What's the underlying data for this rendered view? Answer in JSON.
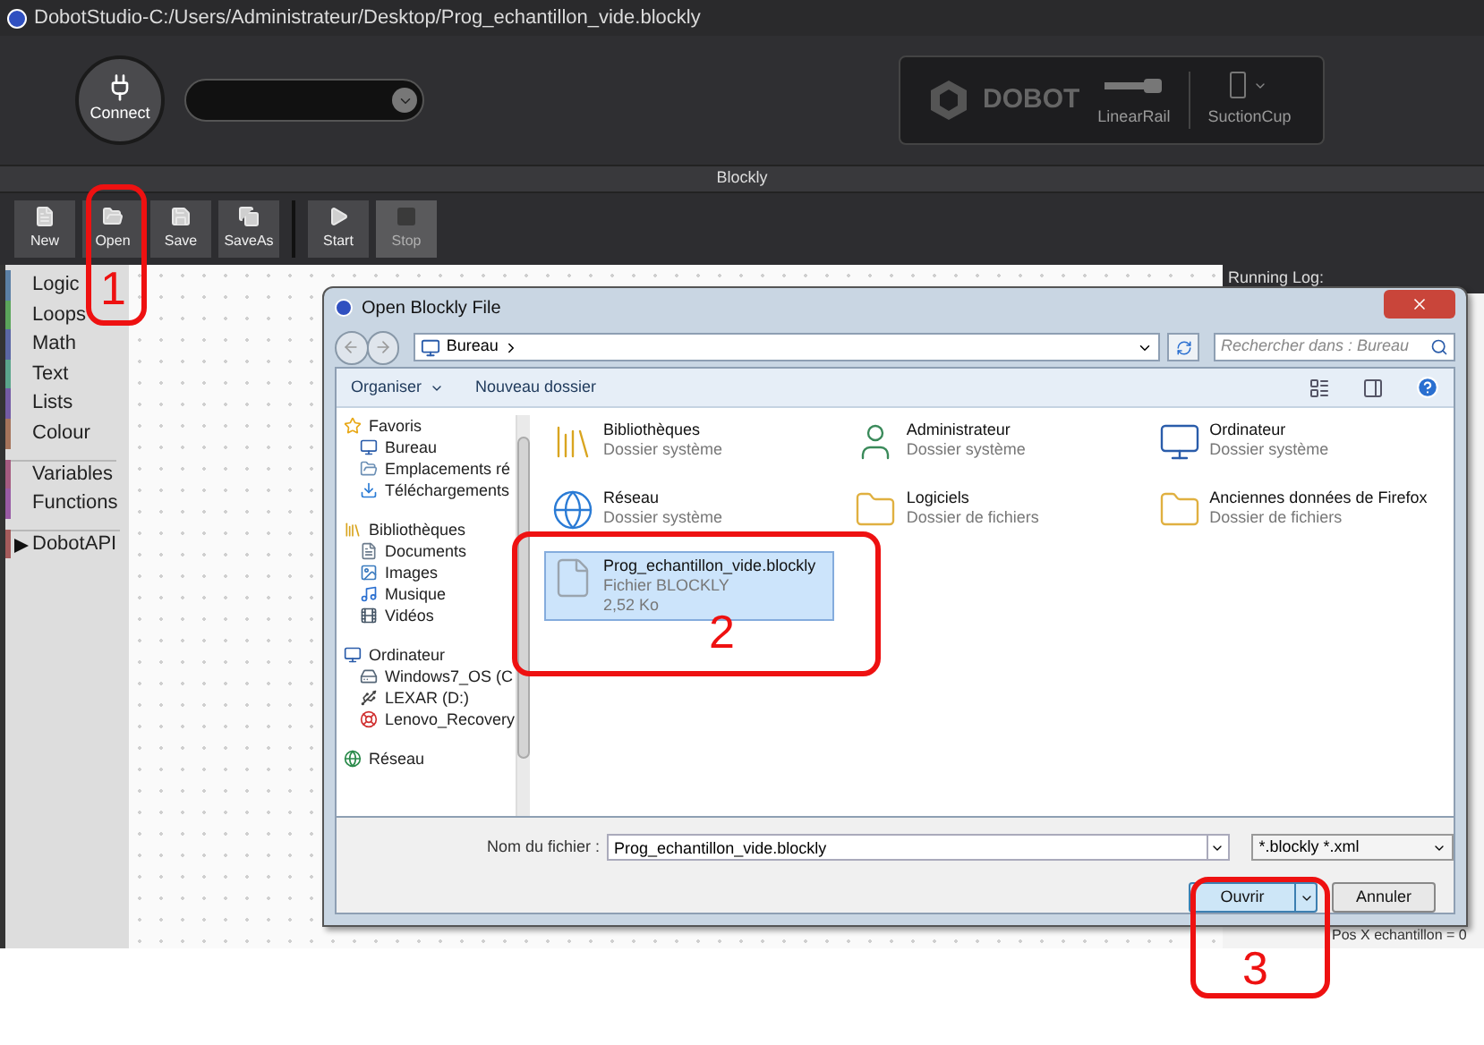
{
  "window": {
    "title": "DobotStudio-C:/Users/Administrateur/Desktop/Prog_echantillon_vide.blockly"
  },
  "header": {
    "connect": {
      "label": "Connect"
    },
    "brand": "DOBOT",
    "devices": [
      {
        "label": "LinearRail",
        "kind": "rail"
      },
      {
        "label": "SuctionCup",
        "kind": "cup"
      }
    ]
  },
  "section_title": "Blockly",
  "toolbar": [
    {
      "label": "New",
      "kind": "new",
      "disabled": false
    },
    {
      "label": "Open",
      "kind": "open",
      "disabled": false
    },
    {
      "label": "Save",
      "kind": "save",
      "disabled": false
    },
    {
      "label": "SaveAs",
      "kind": "saveas",
      "disabled": false
    },
    {
      "label": "Start",
      "kind": "start",
      "disabled": false
    },
    {
      "label": "Stop",
      "kind": "stop",
      "disabled": true
    }
  ],
  "categories": [
    {
      "label": "Logic",
      "color": "#5b80a5",
      "divider_before": false
    },
    {
      "label": "Loops",
      "color": "#5ba55b",
      "divider_before": false
    },
    {
      "label": "Math",
      "color": "#5b67a5",
      "divider_before": false
    },
    {
      "label": "Text",
      "color": "#5ba58c",
      "divider_before": false
    },
    {
      "label": "Lists",
      "color": "#745ba5",
      "divider_before": false
    },
    {
      "label": "Colour",
      "color": "#a5745b",
      "divider_before": false
    },
    {
      "label": "Variables",
      "color": "#a55b80",
      "divider_before": true
    },
    {
      "label": "Functions",
      "color": "#995ba5",
      "divider_before": false
    },
    {
      "label": "DobotAPI",
      "color": "#a55b5b",
      "divider_before": true,
      "expanded": false
    }
  ],
  "running_log": {
    "title": "Running Log:",
    "lines": [
      "Pos X echantillon = 0"
    ]
  },
  "dialog": {
    "title": "Open Blockly File",
    "path": "Bureau",
    "search": {
      "placeholder": "Rechercher dans : Bureau"
    },
    "commands": [
      "Organiser",
      "Nouveau dossier"
    ],
    "nav": [
      {
        "label": "Favoris",
        "kind": "star",
        "children": [
          {
            "label": "Bureau",
            "kind": "desktop"
          },
          {
            "label": "Emplacements ré",
            "kind": "places"
          },
          {
            "label": "Téléchargements",
            "kind": "downloads"
          }
        ]
      },
      {
        "label": "Bibliothèques",
        "kind": "library",
        "children": [
          {
            "label": "Documents",
            "kind": "documents"
          },
          {
            "label": "Images",
            "kind": "images"
          },
          {
            "label": "Musique",
            "kind": "music"
          },
          {
            "label": "Vidéos",
            "kind": "videos"
          }
        ]
      },
      {
        "label": "Ordinateur",
        "kind": "computer",
        "children": [
          {
            "label": "Windows7_OS (C",
            "kind": "drive"
          },
          {
            "label": "LEXAR (D:)",
            "kind": "usb"
          },
          {
            "label": "Lenovo_Recovery",
            "kind": "recovery"
          }
        ]
      },
      {
        "label": "Réseau",
        "kind": "network"
      }
    ],
    "items": [
      {
        "name": "Bibliothèques",
        "type": "Dossier système",
        "kind": "library",
        "selected": false
      },
      {
        "name": "Administrateur",
        "type": "Dossier système",
        "kind": "user",
        "selected": false
      },
      {
        "name": "Ordinateur",
        "type": "Dossier système",
        "kind": "computer",
        "selected": false
      },
      {
        "name": "Réseau",
        "type": "Dossier système",
        "kind": "network",
        "selected": false
      },
      {
        "name": "Logiciels",
        "type": "Dossier de fichiers",
        "kind": "folder",
        "selected": false
      },
      {
        "name": "Anciennes données de Firefox",
        "type": "Dossier de fichiers",
        "kind": "folder",
        "selected": false
      },
      {
        "name": "Prog_echantillon_vide.blockly",
        "type": "Fichier BLOCKLY",
        "size": "2,52 Ko",
        "kind": "file",
        "selected": true
      }
    ],
    "filename_label": "Nom du fichier :",
    "filename": "Prog_echantillon_vide.blockly",
    "filter": "*.blockly *.xml",
    "buttons": [
      {
        "label": "Ouvrir",
        "kind": "primary"
      },
      {
        "label": "Annuler",
        "kind": "secondary"
      }
    ]
  },
  "annotations": [
    {
      "label": "1"
    },
    {
      "label": "2"
    },
    {
      "label": "3"
    }
  ]
}
